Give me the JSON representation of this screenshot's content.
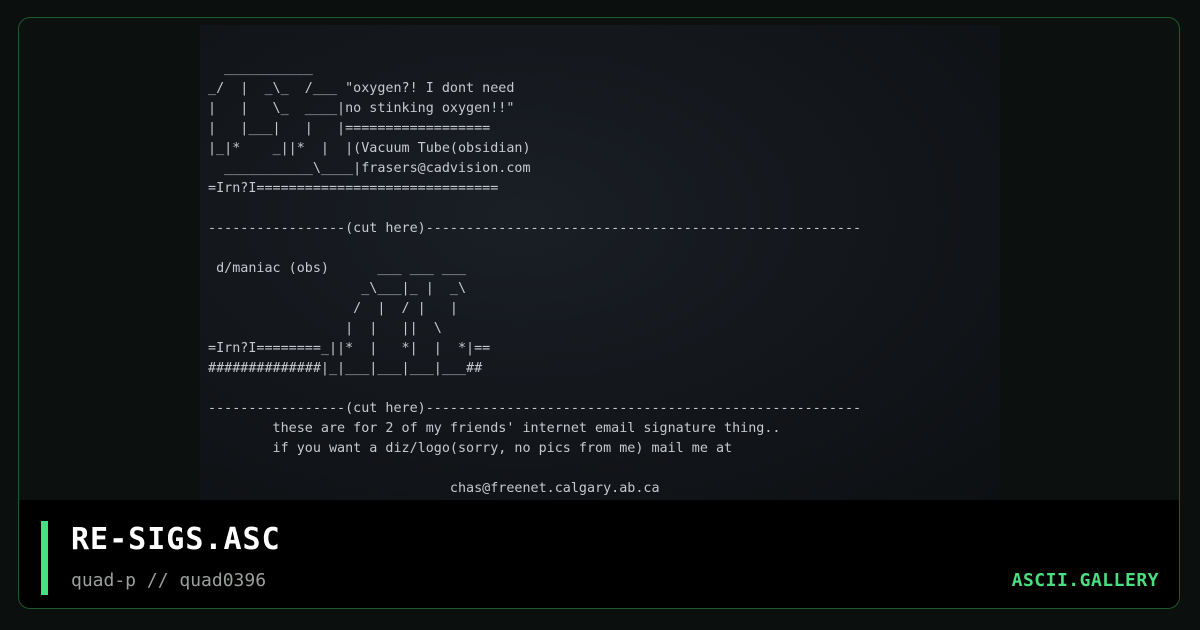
{
  "artwork": {
    "lines": [
      "   ___________",
      " _/  |  _\\_  /___ \"oxygen?! I dont need",
      " |   |   \\_  ____|no stinking oxygen!!\"",
      " |   |___|   |   |==================",
      " |_|*    _||*  |  |(Vacuum Tube(obsidian)",
      "   ___________\\____|frasers@cadvision.com",
      " =Irn?I==============================",
      "",
      " -----------------(cut here)------------------------------------------------------",
      "",
      "  d/maniac (obs)      ___ ___ ___",
      "                    _\\___|_ |  _\\",
      "                   /  |  / |   |",
      "                  |  |   ||  \\",
      " =Irn?I========_||*  |   *|  |  *|==",
      " ##############|_|___|___|___|___##",
      "",
      " -----------------(cut here)------------------------------------------------------",
      "         these are for 2 of my friends' internet email signature thing..",
      "         if you want a diz/logo(sorry, no pics from me) mail me at",
      "",
      "                               chas@freenet.calgary.ab.ca"
    ]
  },
  "footer": {
    "title": "RE-SIGS.ASC",
    "byline": "quad-p // quad0396",
    "brand": "ASCII.GALLERY"
  },
  "colors": {
    "accent": "#4ade80",
    "frame_border": "#1f5a2e",
    "background": "#0b0f0d"
  }
}
